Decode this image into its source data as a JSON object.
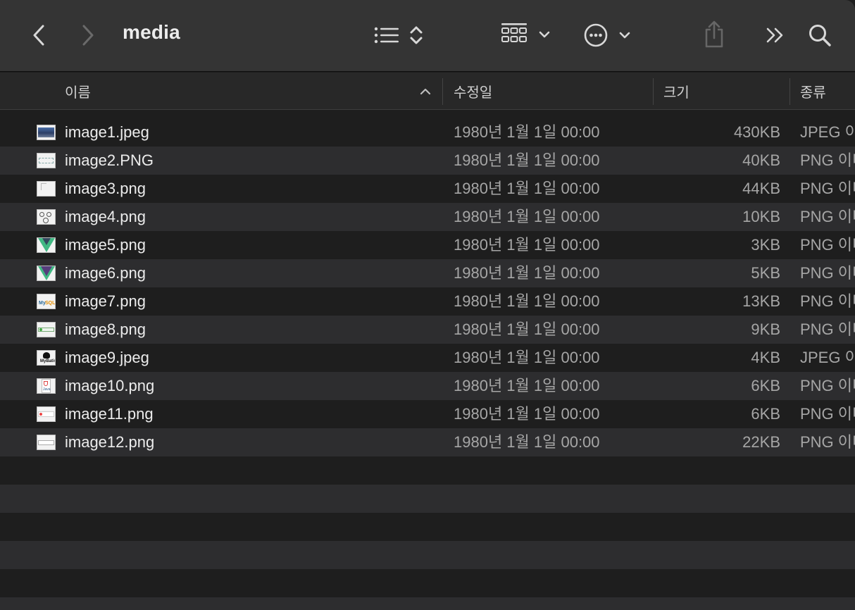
{
  "window": {
    "title": "media"
  },
  "toolbar": {
    "icons": [
      "back-icon",
      "forward-icon",
      "list-view-icon",
      "sort-icon",
      "group-icon",
      "chevron-down-icon",
      "more-icon",
      "share-icon",
      "overflow-icon",
      "search-icon"
    ]
  },
  "columns": {
    "name": "이름",
    "modified": "수정일",
    "size": "크기",
    "kind": "종류"
  },
  "files": [
    {
      "name": "image1.jpeg",
      "date": "1980년 1월 1일 00:00",
      "size": "430KB",
      "kind": "JPEG 이미지",
      "icon": "landscape-thumb"
    },
    {
      "name": "image2.PNG",
      "date": "1980년 1월 1일 00:00",
      "size": "40KB",
      "kind": "PNG 이미지",
      "icon": "diagram-thumb"
    },
    {
      "name": "image3.png",
      "date": "1980년 1월 1일 00:00",
      "size": "44KB",
      "kind": "PNG 이미지",
      "icon": "blank-thumb"
    },
    {
      "name": "image4.png",
      "date": "1980년 1월 1일 00:00",
      "size": "10KB",
      "kind": "PNG 이미지",
      "icon": "people-thumb"
    },
    {
      "name": "image5.png",
      "date": "1980년 1월 1일 00:00",
      "size": "3KB",
      "kind": "PNG 이미지",
      "icon": "vue-logo-thumb"
    },
    {
      "name": "image6.png",
      "date": "1980년 1월 1일 00:00",
      "size": "5KB",
      "kind": "PNG 이미지",
      "icon": "bootstrap-vue-thumb"
    },
    {
      "name": "image7.png",
      "date": "1980년 1월 1일 00:00",
      "size": "13KB",
      "kind": "PNG 이미지",
      "icon": "mysql-thumb"
    },
    {
      "name": "image8.png",
      "date": "1980년 1월 1일 00:00",
      "size": "9KB",
      "kind": "PNG 이미지",
      "icon": "banner-thumb"
    },
    {
      "name": "image9.jpeg",
      "date": "1980년 1월 1일 00:00",
      "size": "4KB",
      "kind": "JPEG 이미지",
      "icon": "mybatis-thumb"
    },
    {
      "name": "image10.png",
      "date": "1980년 1월 1일 00:00",
      "size": "6KB",
      "kind": "PNG 이미지",
      "icon": "java-thumb"
    },
    {
      "name": "image11.png",
      "date": "1980년 1월 1일 00:00",
      "size": "6KB",
      "kind": "PNG 이미지",
      "icon": "logo-banner-thumb"
    },
    {
      "name": "image12.png",
      "date": "1980년 1월 1일 00:00",
      "size": "22KB",
      "kind": "PNG 이미지",
      "icon": "wide-thumb"
    }
  ],
  "colors": {
    "toolbar_bg": "#343434",
    "row_odd": "#2d2d2f",
    "row_even": "#1e1e1e",
    "text_primary": "#ececec",
    "text_secondary": "#a6a6a6"
  }
}
